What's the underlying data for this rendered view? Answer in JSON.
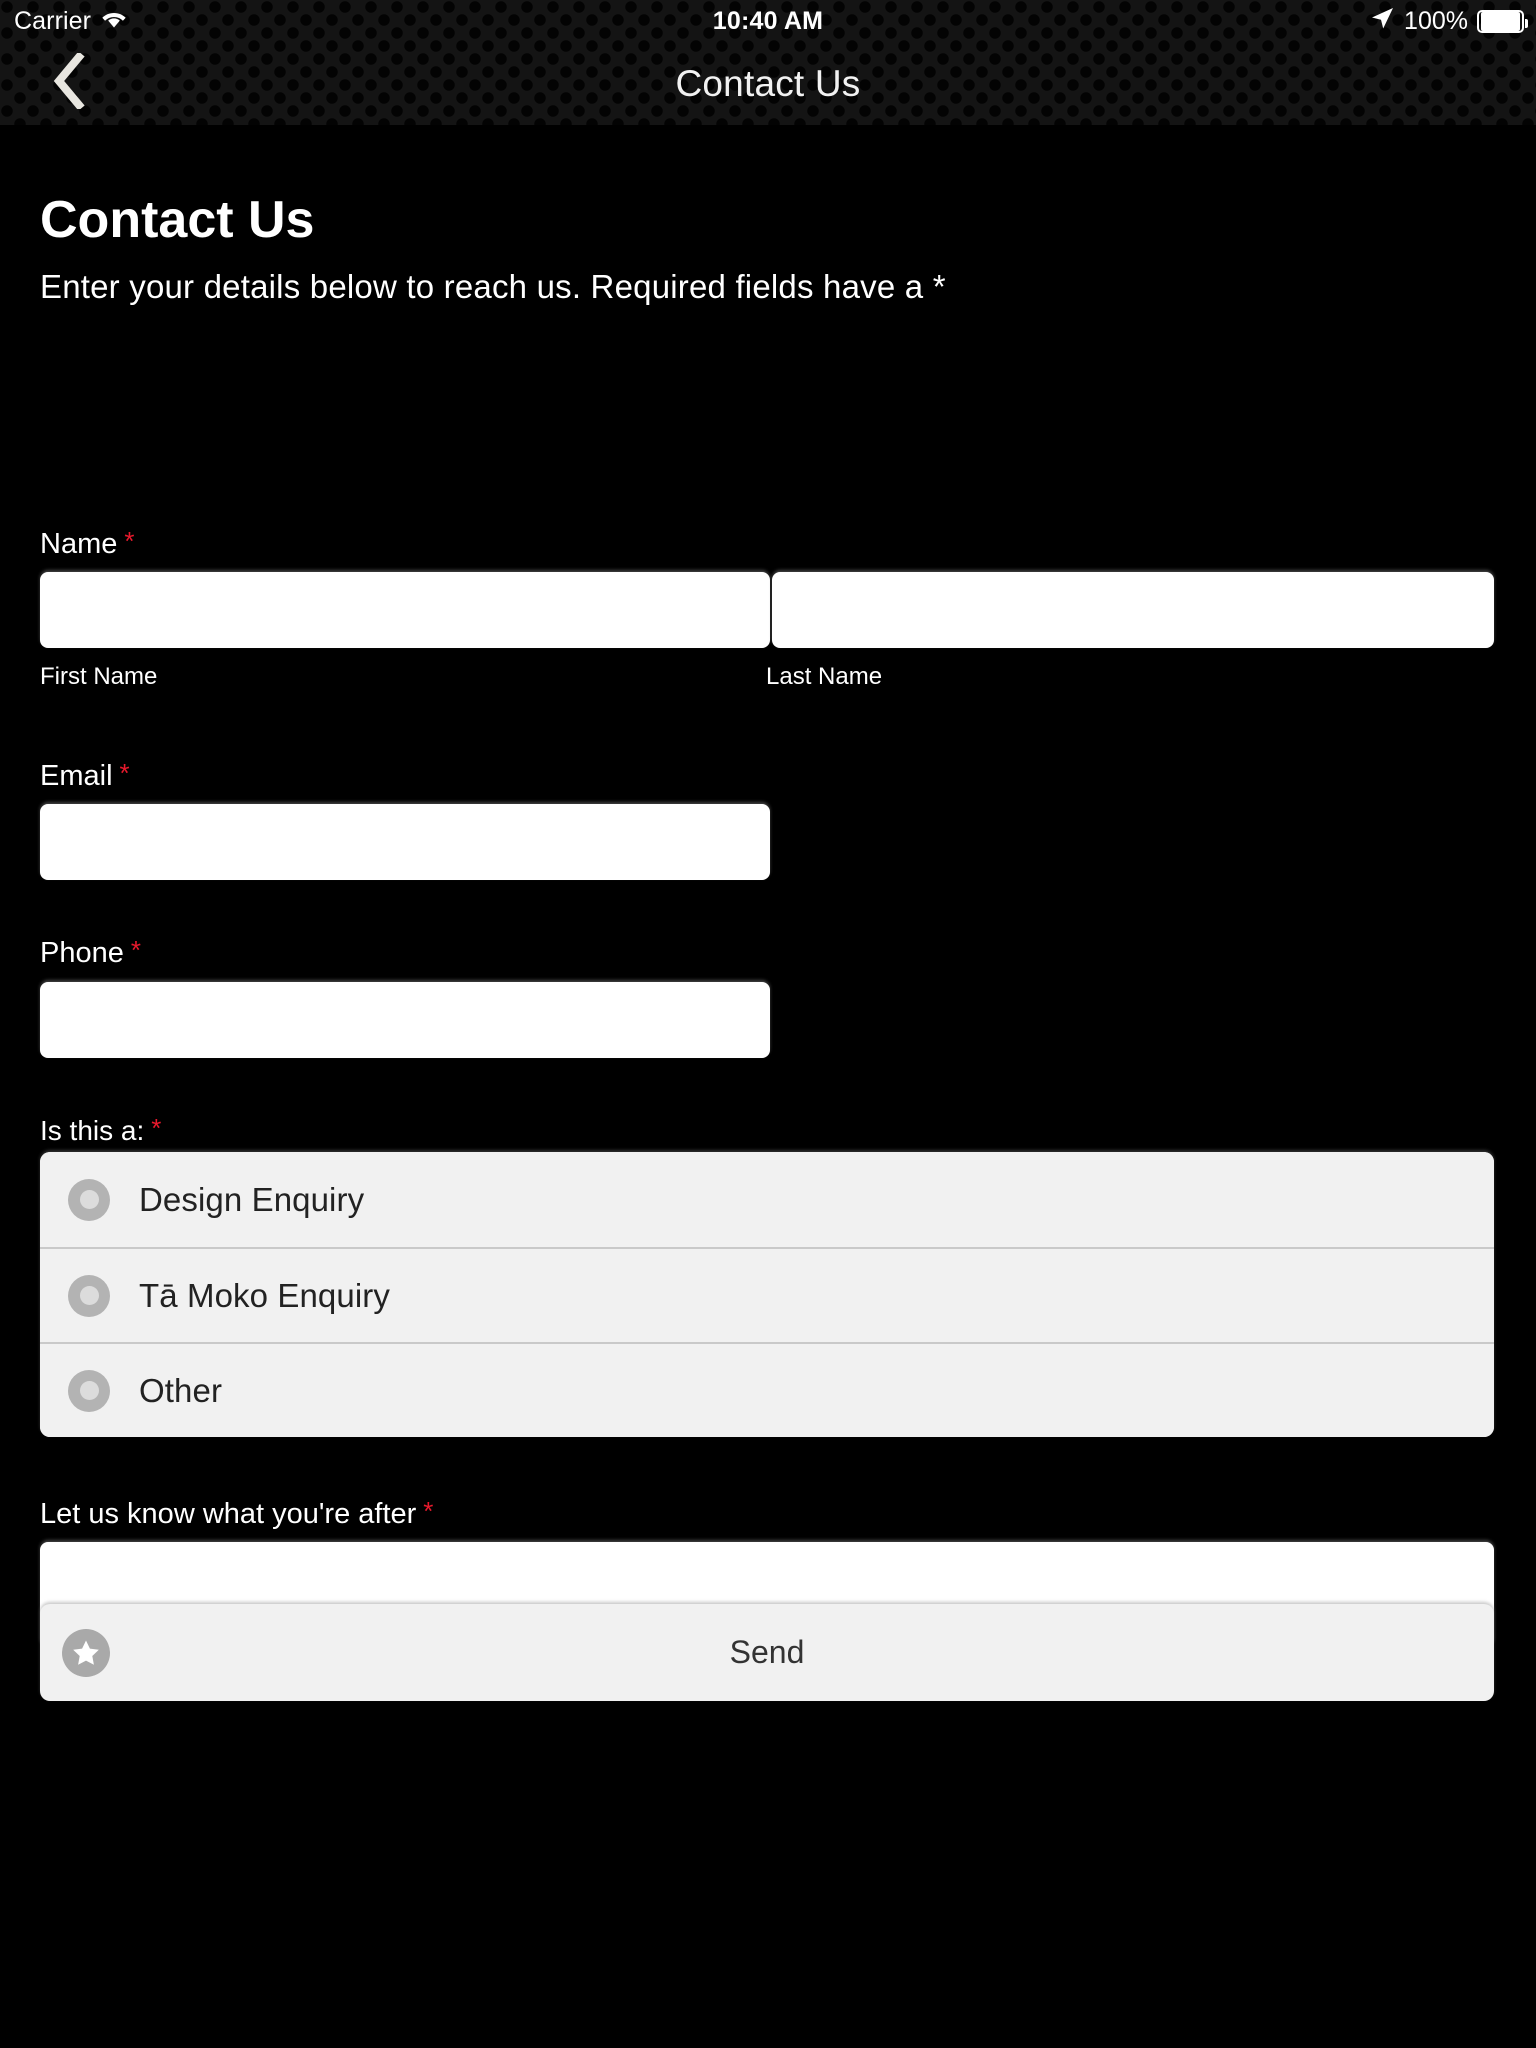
{
  "status_bar": {
    "carrier": "Carrier",
    "wifi_icon": "wifi-icon",
    "time": "10:40 AM",
    "location_icon": "location-arrow-icon",
    "battery_percent": "100%",
    "battery_icon": "battery-full-icon"
  },
  "nav": {
    "back_icon": "chevron-left-icon",
    "title": "Contact Us"
  },
  "page": {
    "title": "Contact Us",
    "subtitle": "Enter your details below to reach us. Required fields have a *"
  },
  "form": {
    "name": {
      "label": "Name",
      "required_marker": "*",
      "first": {
        "value": "",
        "placeholder": "",
        "sub_label": "First Name"
      },
      "last": {
        "value": "",
        "placeholder": "",
        "sub_label": "Last Name"
      }
    },
    "email": {
      "label": "Email",
      "required_marker": "*",
      "value": "",
      "placeholder": ""
    },
    "phone": {
      "label": "Phone",
      "required_marker": "*",
      "value": "",
      "placeholder": ""
    },
    "enquiry_type": {
      "label": "Is this a:",
      "required_marker": "*",
      "selected": null,
      "options": [
        {
          "label": "Design Enquiry",
          "selected": false
        },
        {
          "label": "Tā Moko Enquiry",
          "selected": false
        },
        {
          "label": "Other",
          "selected": false
        }
      ]
    },
    "message": {
      "label": "Let us know what you're after",
      "required_marker": "*",
      "value": "",
      "placeholder": ""
    },
    "submit": {
      "label": "Send",
      "icon": "star-icon"
    }
  },
  "colors": {
    "background": "#000000",
    "navbar": "#141414",
    "required_red": "#e8192c",
    "input_white": "#ffffff",
    "panel_gray": "#f1f1f1",
    "radio_gray": "#b3b3b3",
    "text_white": "#ffffff"
  }
}
